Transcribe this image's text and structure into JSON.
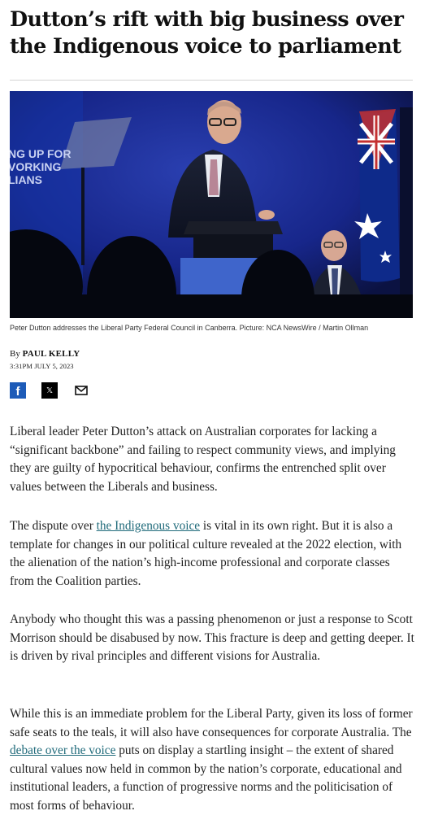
{
  "article": {
    "headline": "Dutton’s rift with big business over the Indigenous voice to parliament",
    "image_caption": "Peter Dutton addresses the Liberal Party Federal Council in Canberra. Picture: NCA NewsWire / Martin Ollman",
    "image_backdrop_text": [
      "NG UP FOR",
      "VORKING",
      "LIANS"
    ],
    "byline_prefix": "By",
    "author": "PAUL KELLY",
    "timestamp": "3:31PM JULY 5, 2023",
    "share": {
      "facebook_icon": "f",
      "x_icon": "𝕏",
      "email_icon": "envelope-icon"
    },
    "paragraphs": {
      "p1": "Liberal leader Peter Dutton’s attack on Australian corporates for lacking a “significant backbone” and failing to respect community views, and implying they are guilty of hypocritical behaviour, confirms the entrenched split over values between the Liberals and business.",
      "p2_before": "The dispute over ",
      "p2_link": "the Indigenous voice",
      "p2_after": " is vital in its own right. But it is also a template for changes in our political culture revealed at the 2022 election, with the alienation of the nation’s high-income professional and corporate classes from the Coalition parties.",
      "p3": "Anybody who thought this was a passing phenomenon or just a response to Scott Morrison should be disabused by now. This fracture is deep and getting deeper. It is driven by rival principles and different visions for Australia.",
      "p4_before": "While this is an immediate problem for the Liberal Party, given its loss of former safe seats to the teals, it will also have consequences for corporate Australia. The ",
      "p4_link": "debate over the voice",
      "p4_after": " puts on display a startling insight – the extent of shared cultural values now held in common by the nation’s corporate, educational and institutional leaders, a function of progressive norms and the politicisation of most forms of behaviour."
    }
  },
  "colors": {
    "link": "#1f6a7a",
    "facebook": "#1d5bb8",
    "backdrop": "#1a2a7a"
  }
}
